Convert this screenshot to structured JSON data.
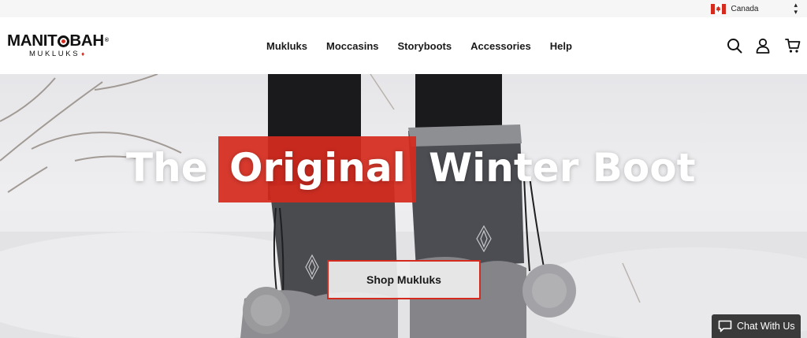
{
  "topbar": {
    "country": "Canada",
    "country_icon": "canada-flag-icon",
    "selector_icon": "up-down-arrows-icon"
  },
  "header": {
    "logo": {
      "main": "MANITOBAH",
      "sub": "MUKLUKS",
      "registered": "®"
    },
    "nav": [
      {
        "label": "Mukluks"
      },
      {
        "label": "Moccasins"
      },
      {
        "label": "Storyboots"
      },
      {
        "label": "Accessories"
      },
      {
        "label": "Help"
      }
    ],
    "icons": [
      "search-icon",
      "account-icon",
      "cart-icon"
    ]
  },
  "hero": {
    "headline": {
      "word1": "The",
      "word2": "Original",
      "word3": "Winter Boot"
    },
    "cta_label": "Shop Mukluks"
  },
  "chat": {
    "label": "Chat With Us",
    "icon": "chat-bubble-icon"
  },
  "colors": {
    "accent": "#d52b1e",
    "chat_bg": "#3a3a3a",
    "topbar_bg": "#f6f6f6"
  }
}
